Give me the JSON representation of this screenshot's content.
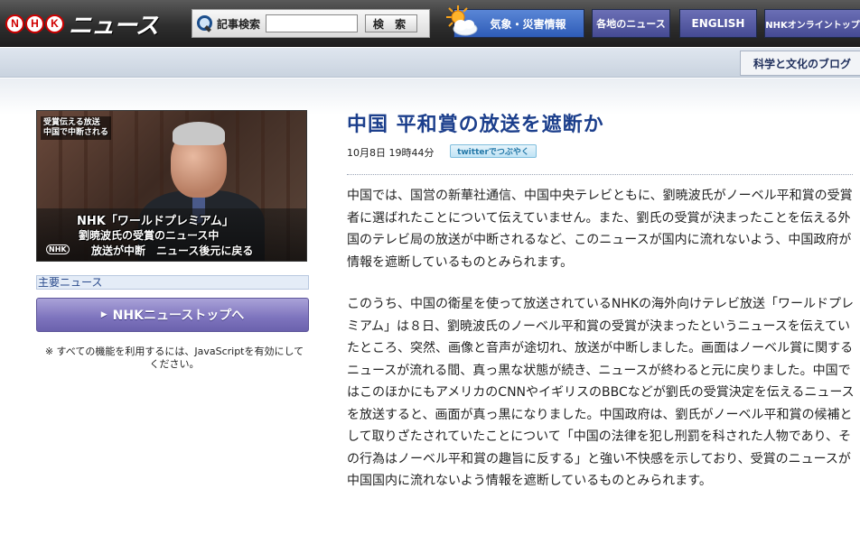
{
  "header": {
    "logo_letters": [
      "N",
      "H",
      "K"
    ],
    "logo_text": "ニュース",
    "search": {
      "label": "記事検索",
      "placeholder": "",
      "button": "検 索"
    },
    "nav": {
      "weather": "気象・災害情報",
      "local": "各地のニュース",
      "english": "ENGLISH",
      "online": "NHKオンライントップ"
    }
  },
  "subheader": {
    "blog_tab": "科学と文化のブログ"
  },
  "sidebar": {
    "video": {
      "caption_top": [
        "受賞伝える放送",
        "中国で中断される"
      ],
      "line1": "NHK「ワールドプレミアム」",
      "line2": "劉暁波氏の受賞のニュース中",
      "line3": "放送が中断　ニュース後元に戻る",
      "logo": "NHK"
    },
    "main_news_label": "主要ニュース",
    "top_button": "NHKニューストップへ",
    "js_note": "※ すべての機能を利用するには、JavaScriptを有効にしてください。"
  },
  "article": {
    "title": "中国 平和賞の放送を遮断か",
    "date": "10月8日 19時44分",
    "twitter": "twitterでつぶやく",
    "paragraphs": [
      "中国では、国営の新華社通信、中国中央テレビともに、劉暁波氏がノーベル平和賞の受賞者に選ばれたことについて伝えていません。また、劉氏の受賞が決まったことを伝える外国のテレビ局の放送が中断されるなど、このニュースが国内に流れないよう、中国政府が情報を遮断しているものとみられます。",
      "このうち、中国の衛星を使って放送されているNHKの海外向けテレビ放送「ワールドプレミアム」は８日、劉暁波氏のノーベル平和賞の受賞が決まったというニュースを伝えていたところ、突然、画像と音声が途切れ、放送が中断しました。画面はノーベル賞に関するニュースが流れる間、真っ黒な状態が続き、ニュースが終わると元に戻りました。中国ではこのほかにもアメリカのCNNやイギリスのBBCなどが劉氏の受賞決定を伝えるニュースを放送すると、画面が真っ黒になりました。中国政府は、劉氏がノーベル平和賞の候補として取りざたされていたことについて「中国の法律を犯し刑罰を科された人物であり、その行為はノーベル平和賞の趣旨に反する」と強い不快感を示しており、受賞のニュースが中国国内に流れないよう情報を遮断しているものとみられます。"
    ]
  },
  "colors": {
    "header_bg": "#2e2e2e",
    "title_blue": "#1c3f8c",
    "button_purple": "#7d73bd",
    "logo_red": "#d00000"
  }
}
